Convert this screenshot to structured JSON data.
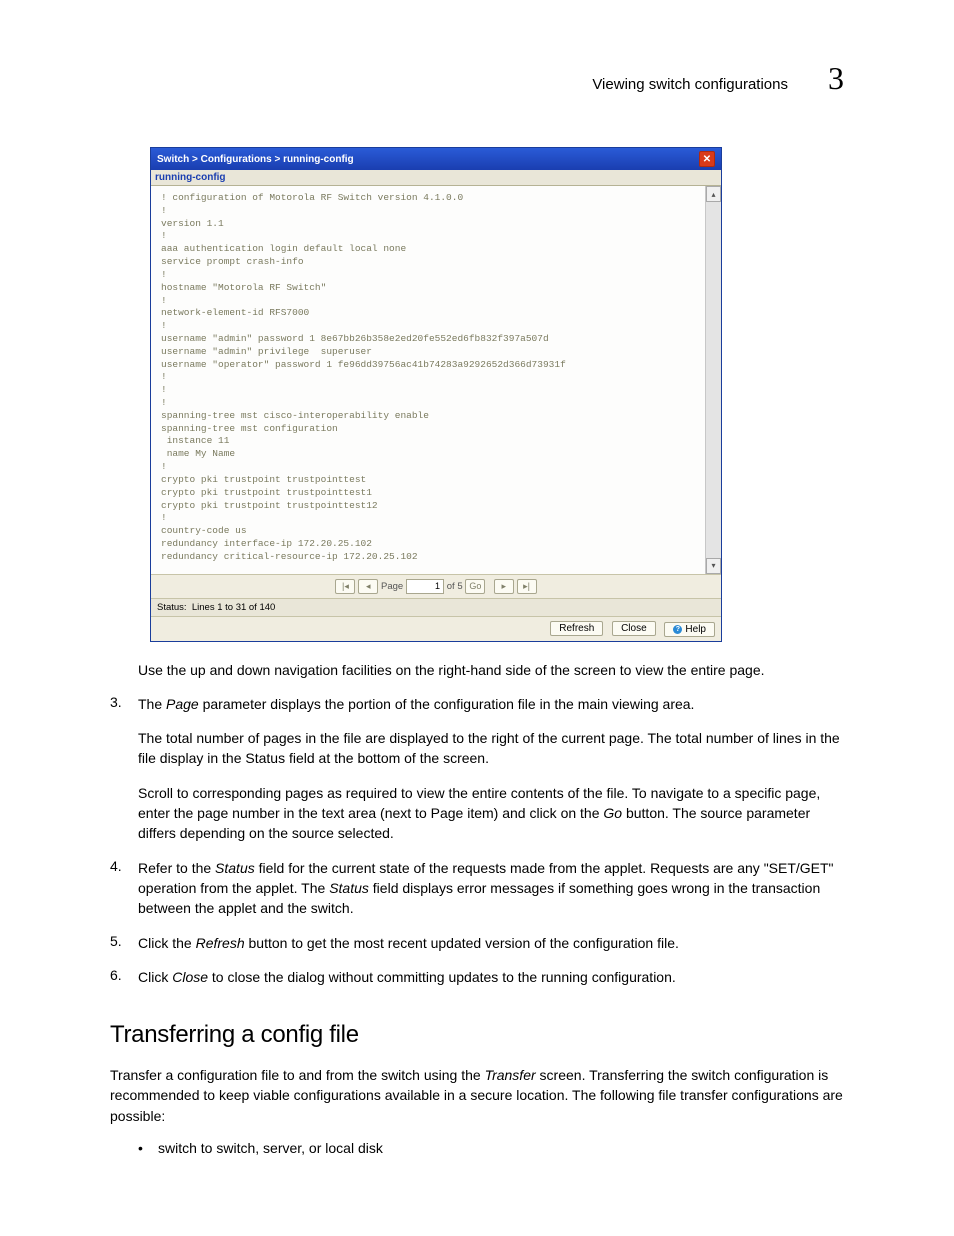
{
  "header": {
    "text": "Viewing switch configurations",
    "chapter": "3"
  },
  "dialog": {
    "title": "Switch > Configurations > running-config",
    "close_aria": "close",
    "subtitle": "running-config",
    "config_text": "! configuration of Motorola RF Switch version 4.1.0.0\n!\nversion 1.1\n!\naaa authentication login default local none\nservice prompt crash-info\n!\nhostname \"Motorola RF Switch\"\n!\nnetwork-element-id RFS7000\n!\nusername \"admin\" password 1 8e67bb26b358e2ed20fe552ed6fb832f397a507d\nusername \"admin\" privilege  superuser\nusername \"operator\" password 1 fe96dd39756ac41b74283a9292652d366d73931f\n!\n!\n!\nspanning-tree mst cisco-interoperability enable\nspanning-tree mst configuration\n instance 11\n name My Name\n!\ncrypto pki trustpoint trustpointtest\ncrypto pki trustpoint trustpointtest1\ncrypto pki trustpoint trustpointtest12\n!\ncountry-code us\nredundancy interface-ip 172.20.25.102\nredundancy critical-resource-ip 172.20.25.102",
    "pager": {
      "first": "|◂",
      "prev": "◂",
      "page_label": "Page",
      "page_value": "1",
      "of_label": "of 5",
      "go": "Go",
      "next": "▸",
      "last": "▸|"
    },
    "status_label": "Status:",
    "status_text": "Lines 1 to 31 of 140",
    "buttons": {
      "refresh": "Refresh",
      "close": "Close",
      "help": "Help"
    }
  },
  "body": {
    "caption": "Use the up and down navigation facilities on the right-hand side of the screen to view the entire page.",
    "step3_a": "The ",
    "step3_term": "Page",
    "step3_b": " parameter displays the portion of the configuration file in the main viewing area.",
    "step3_p2": "The total number of pages in the file are displayed to the right of the current page. The total number of lines in the file display in the Status field at the bottom of the screen.",
    "step3_p3a": "Scroll to corresponding pages as required to view the entire contents of the file. To navigate to a specific page, enter the page number in the text area (next to Page item) and click on the ",
    "step3_p3_term": "Go",
    "step3_p3b": " button. The source parameter differs depending on the source selected.",
    "step4_a": "Refer to the ",
    "step4_term1": "Status",
    "step4_b": " field for the current state of the requests made from the applet. Requests are any \"SET/GET\" operation from the applet. The ",
    "step4_term2": "Status",
    "step4_c": " field displays error messages if something goes wrong in the transaction between the applet and the switch.",
    "step5_a": "Click the ",
    "step5_term": "Refresh",
    "step5_b": " button to get the most recent updated version of the configuration file.",
    "step6_a": "Click ",
    "step6_term": "Close",
    "step6_b": " to close the dialog without committing updates to the running configuration.",
    "section_heading": "Transferring a config file",
    "transfer_p1a": "Transfer a configuration file to and from the switch using the ",
    "transfer_term": "Transfer",
    "transfer_p1b": " screen. Transferring the switch configuration is recommended to keep viable configurations available in a secure location. The following file transfer configurations are possible:",
    "bullet1": "switch to switch, server, or local disk",
    "nums": {
      "n3": "3.",
      "n4": "4.",
      "n5": "5.",
      "n6": "6."
    }
  }
}
